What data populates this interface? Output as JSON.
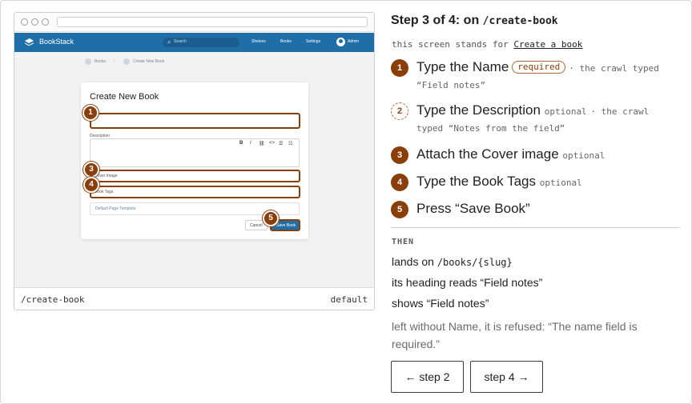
{
  "preview": {
    "app_name": "BookStack",
    "search_placeholder": "Search",
    "nav": [
      "Shelves",
      "Books",
      "Settings"
    ],
    "user": "Admin",
    "breadcrumbs": [
      "Books",
      "Create New Book"
    ],
    "form_title": "Create New Book",
    "description_label": "Description",
    "editor_tools": [
      "B",
      "I",
      "⛓",
      "<>",
      "☰",
      "☷"
    ],
    "cover_label": "Cover Image",
    "tags_label": "Book Tags",
    "template_label": "Default Page Template",
    "cancel_label": "Cancel",
    "save_label": "Save Book",
    "path": "/create-book",
    "variant": "default",
    "markers": [
      "1",
      "3",
      "4",
      "5"
    ]
  },
  "step": {
    "heading_prefix": "Step 3 of 4: on ",
    "heading_path": "/create-book",
    "stands_for_prefix": "this screen stands for ",
    "stands_for_link": "Create a book"
  },
  "actions": [
    {
      "num": "1",
      "label": "Type the Name",
      "tag": "required",
      "note": "· the crawl typed",
      "note2": "“Field notes”"
    },
    {
      "num": "2",
      "label": "Type the Description",
      "tag": "optional",
      "note": "· the crawl",
      "note2": "typed “Notes from the field”"
    },
    {
      "num": "3",
      "label": "Attach the Cover image",
      "tag": "optional"
    },
    {
      "num": "4",
      "label": "Type the Book Tags",
      "tag": "optional"
    },
    {
      "num": "5",
      "label": "Press “Save Book”"
    }
  ],
  "then": {
    "label": "THEN",
    "lands_prefix": "lands on ",
    "lands_path": "/books/{slug}",
    "heading_reads": "its heading reads “Field notes”",
    "shows": "shows “Field notes”",
    "refused": "left without Name, it is refused: “The name field is required.”"
  },
  "nav_buttons": {
    "prev": "← step 2",
    "next": "step 4 →"
  },
  "colors": {
    "accent": "#8a3e0a",
    "app_bar": "#206ea7"
  }
}
